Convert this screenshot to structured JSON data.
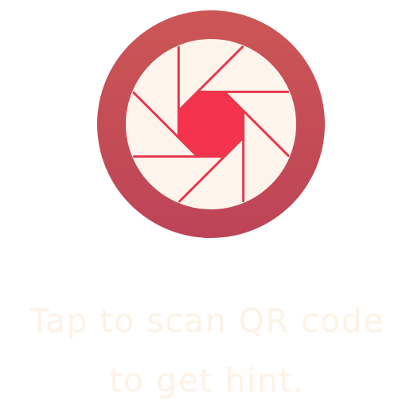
{
  "scan_button": {
    "icon": "camera-aperture-icon",
    "ring_color_top": "#cc5656",
    "ring_color_bottom": "#bd4457",
    "inner_color": "#fdf4ec",
    "center_color": "#f5334d",
    "blade_line_color": "#e8384f"
  },
  "hint": {
    "line1": "Tap to scan QR code",
    "line2": "to get hint.",
    "color": "#fdf2e6"
  }
}
